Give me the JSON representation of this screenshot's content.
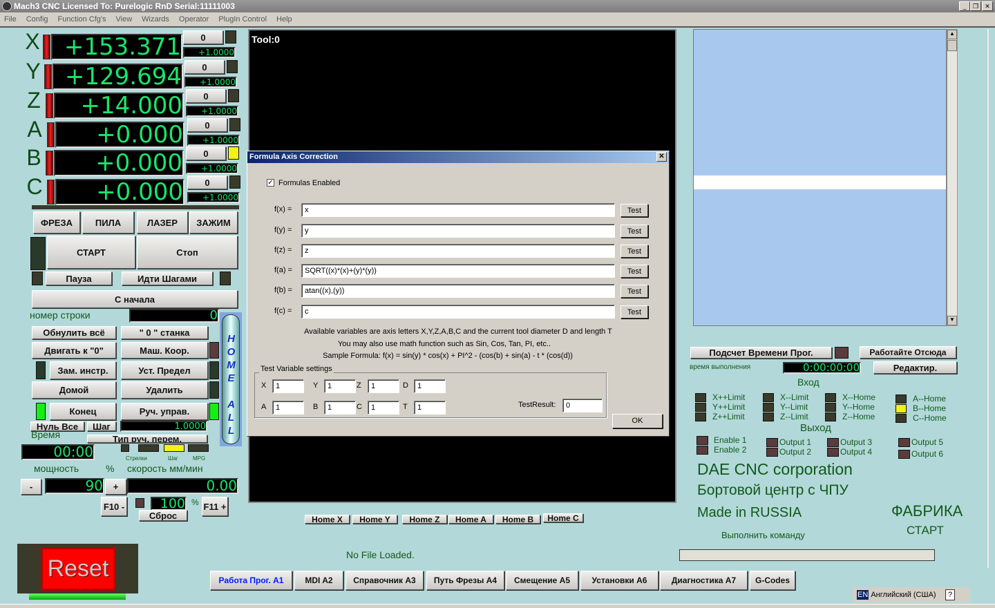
{
  "window": {
    "title": "Mach3 CNC  Licensed To: Purelogic RnD Serial:11111003"
  },
  "menu": [
    "File",
    "Config",
    "Function Cfg's",
    "View",
    "Wizards",
    "Operator",
    "PlugIn Control",
    "Help"
  ],
  "axes": [
    {
      "letter": "X",
      "value": "+153.371",
      "zero": "0",
      "scale": "+1.0000",
      "led": "dark"
    },
    {
      "letter": "Y",
      "value": "+129.694",
      "zero": "0",
      "scale": "+1.0000",
      "led": "dark"
    },
    {
      "letter": "Z",
      "value": "+14.000",
      "zero": "0",
      "scale": "+1.0000",
      "led": "dark"
    },
    {
      "letter": "A",
      "value": "+0.000",
      "zero": "0",
      "scale": "+1.0000",
      "led": "dark"
    },
    {
      "letter": "B",
      "value": "+0.000",
      "zero": "0",
      "scale": "+1.0000",
      "led": "yellow"
    },
    {
      "letter": "C",
      "value": "+0.000",
      "zero": "0",
      "scale": "+1.0000",
      "led": "dark"
    }
  ],
  "modes": [
    "ФРЕЗА",
    "ПИЛА",
    "ЛАЗЕР",
    "ЗАЖИМ"
  ],
  "controls": {
    "start": "СТАРТ",
    "stop": "Стоп",
    "pause": "Пауза",
    "step_go": "Идти Шагами",
    "from_start": "С начала",
    "line_label": "номер строки",
    "line_value": "0",
    "zero_all": "Обнулить всё",
    "machine_zero": "\" 0 \" станка",
    "goto_zero": "Двигать к \"0\"",
    "mach_coords": "Маш. Коор.",
    "tool_change": "Зам. инстр.",
    "set_limit": "Уст. Предел",
    "home": "Домой",
    "delete": "Удалить",
    "end": "Конец",
    "jog": "Руч. управ.",
    "null_all": "Нуль Все",
    "step": "Шаг",
    "step_value": "1.0000",
    "jog_type": "Тип руч. перем.",
    "time_label": "Время",
    "time_value": "00:00",
    "jog_modes": [
      "Стрелки",
      "Шаг",
      "MPG"
    ],
    "power_label": "мощность",
    "percent": "%",
    "speed_label": "скорость мм/мин",
    "minus": "-",
    "plus": "+",
    "power_value": "90",
    "speed_value": "0.00",
    "f10": "F10 -",
    "f11": "F11 +",
    "override_value": "100",
    "override_pct": "%",
    "reset_override": "Сброс",
    "home_all": "HOME ALL",
    "reset": "Reset"
  },
  "toolpath": {
    "tool": "Tool:0"
  },
  "home_buttons": [
    "Home X",
    "Home Y",
    "Home Z",
    "Home A",
    "Home B",
    "Home C"
  ],
  "status": {
    "file": "No File Loaded."
  },
  "dialog": {
    "title": "Formula Axis Correction",
    "enabled_label": "Formulas Enabled",
    "enabled": true,
    "formulas": [
      {
        "label": "f(x) =",
        "value": "x"
      },
      {
        "label": "f(y) =",
        "value": "y"
      },
      {
        "label": "f(z) =",
        "value": "z"
      },
      {
        "label": "f(a) =",
        "value": "SQRT((x)*(x)+(y)*(y))"
      },
      {
        "label": "f(b) =",
        "value": "atan((x),(y))"
      },
      {
        "label": "f(c) =",
        "value": "c"
      }
    ],
    "test_label": "Test",
    "info1": "Available variables are axis letters X,Y,Z,A,B,C and the current tool diameter D and length T",
    "info2": "You may also use math function such as Sin, Cos, Tan, PI, etc..",
    "info3": "Sample Formula: f(x) =  sin(y) * cos(x) + PI^2 - (cos(b) + sin(a) - t * (cos(d))",
    "group": "Test Variable settings",
    "vars": [
      {
        "label": "X",
        "value": "1"
      },
      {
        "label": "Y",
        "value": "1"
      },
      {
        "label": "Z",
        "value": "1"
      },
      {
        "label": "D",
        "value": "1"
      },
      {
        "label": "A",
        "value": "1"
      },
      {
        "label": "B",
        "value": "1"
      },
      {
        "label": "C",
        "value": "1"
      },
      {
        "label": "T",
        "value": "1"
      }
    ],
    "result_label": "TestResult:",
    "result_value": "0",
    "ok": "OK"
  },
  "right": {
    "calc_time": "Подсчет Времени Прог.",
    "run_from_here": "Работайте Отсюда",
    "exec_time_label": "время выполнения",
    "exec_time": "0:00:00:00",
    "edit": "Редактир.",
    "inputs_title": "Вход",
    "outputs_title": "Выход",
    "inputs": [
      [
        "X++Limit",
        "Y++Limit",
        "Z++Limit"
      ],
      [
        "X--Limit",
        "Y--Limit",
        "Z--Limit"
      ],
      [
        "X--Home",
        "Y--Home",
        "Z--Home"
      ],
      [
        "A--Home",
        "B--Home",
        "C--Home"
      ]
    ],
    "outputs": [
      [
        "Enable 1",
        "Enable 2"
      ],
      [
        "Output 1",
        "Output 2"
      ],
      [
        "Output 3",
        "Output 4"
      ],
      [
        "Output 5",
        "Output 6"
      ]
    ],
    "brand1": "DAE CNC corporation",
    "brand2": "Бортовой центр с ЧПУ",
    "brand3": "Made in RUSSIA",
    "factory1": "ФАБРИКА",
    "factory2": "СТАРТ",
    "mdi_label": "Выполнить команду"
  },
  "tabs": [
    "Работа Прог. A1",
    "MDI A2",
    "Справочник A3",
    "Путь Фрезы A4",
    "Смещение A5",
    "Установки A6",
    "Диагностика A7",
    "G-Codes"
  ],
  "active_tab": 0,
  "taskbar": {
    "lang_code": "EN",
    "lang": "Английский (США)",
    "help": "?"
  },
  "colors": {
    "dro_text": "#19e66b",
    "background": "#b3d8d9",
    "active_tab_text": "#0018ff"
  }
}
